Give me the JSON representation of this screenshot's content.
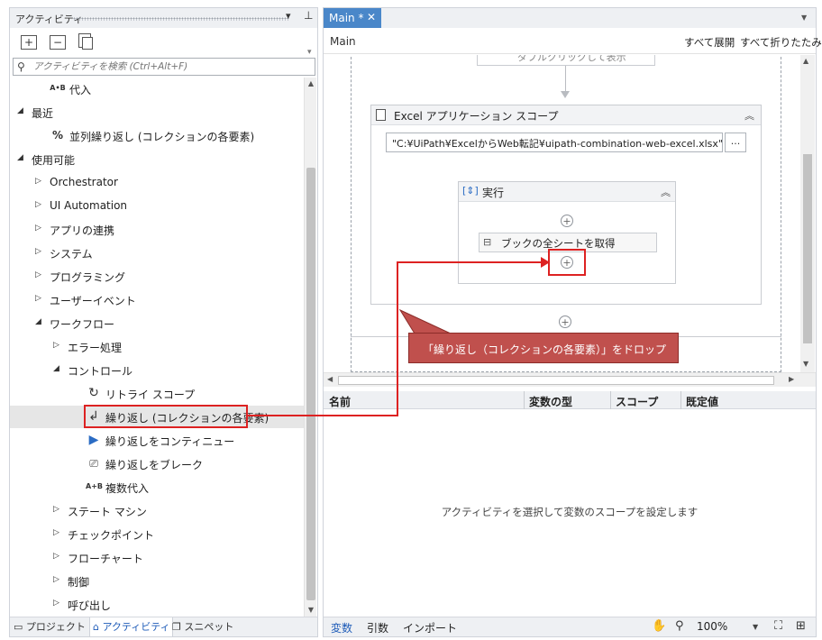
{
  "left_panel": {
    "title": "アクティビティ",
    "search_placeholder": "アクティビティを検索 (Ctrl+Alt+F)",
    "tree": [
      {
        "label": "代入",
        "icon": "A•B"
      },
      {
        "label": "最近",
        "expanded": true
      },
      {
        "label": "並列繰り返し (コレクションの各要素)",
        "icon": "%"
      },
      {
        "label": "使用可能",
        "expanded": true
      },
      {
        "label": "Orchestrator"
      },
      {
        "label": "UI Automation"
      },
      {
        "label": "アプリの連携"
      },
      {
        "label": "システム"
      },
      {
        "label": "プログラミング"
      },
      {
        "label": "ユーザーイベント"
      },
      {
        "label": "ワークフロー",
        "expanded": true
      },
      {
        "label": "エラー処理"
      },
      {
        "label": "コントロール",
        "expanded": true
      },
      {
        "label": "リトライ スコープ",
        "icon": "↻"
      },
      {
        "label": "繰り返し (コレクションの各要素)",
        "icon": "↲",
        "selected": true
      },
      {
        "label": "繰り返しをコンティニュー",
        "icon": "▶"
      },
      {
        "label": "繰り返しをブレーク",
        "icon": "⎚"
      },
      {
        "label": "複数代入",
        "icon": "A+B"
      },
      {
        "label": "ステート マシン"
      },
      {
        "label": "チェックポイント"
      },
      {
        "label": "フローチャート"
      },
      {
        "label": "制御"
      },
      {
        "label": "呼び出し"
      }
    ],
    "bottom_tabs": {
      "project": "プロジェクト",
      "activities": "アクティビティ",
      "snippets": "スニペット"
    }
  },
  "designer": {
    "tab_label": "Main *",
    "breadcrumb": "Main",
    "expand_all": "すべて展開",
    "collapse_all": "すべて折りたたみ",
    "top_activity_hint": "ダブルクリックして表示",
    "excel_scope": {
      "title": "Excel アプリケーション スコープ",
      "path": "\"C:¥UiPath¥ExcelからWeb転記¥uipath-combination-web-excel.xlsx\"",
      "browse": "..."
    },
    "do_block": {
      "title": "実行",
      "child": "ブックの全シートを取得"
    },
    "variables_columns": {
      "name": "名前",
      "type": "変数の型",
      "scope": "スコープ",
      "default": "既定値"
    },
    "variables_empty": "アクティビティを選択して変数のスコープを設定します",
    "bottom_tabs": {
      "variables": "変数",
      "arguments": "引数",
      "imports": "インポート"
    },
    "zoom": "100%"
  },
  "annotation": {
    "callout": "「繰り返し（コレクションの各要素）」をドロップ",
    "color": "#c0504d"
  }
}
